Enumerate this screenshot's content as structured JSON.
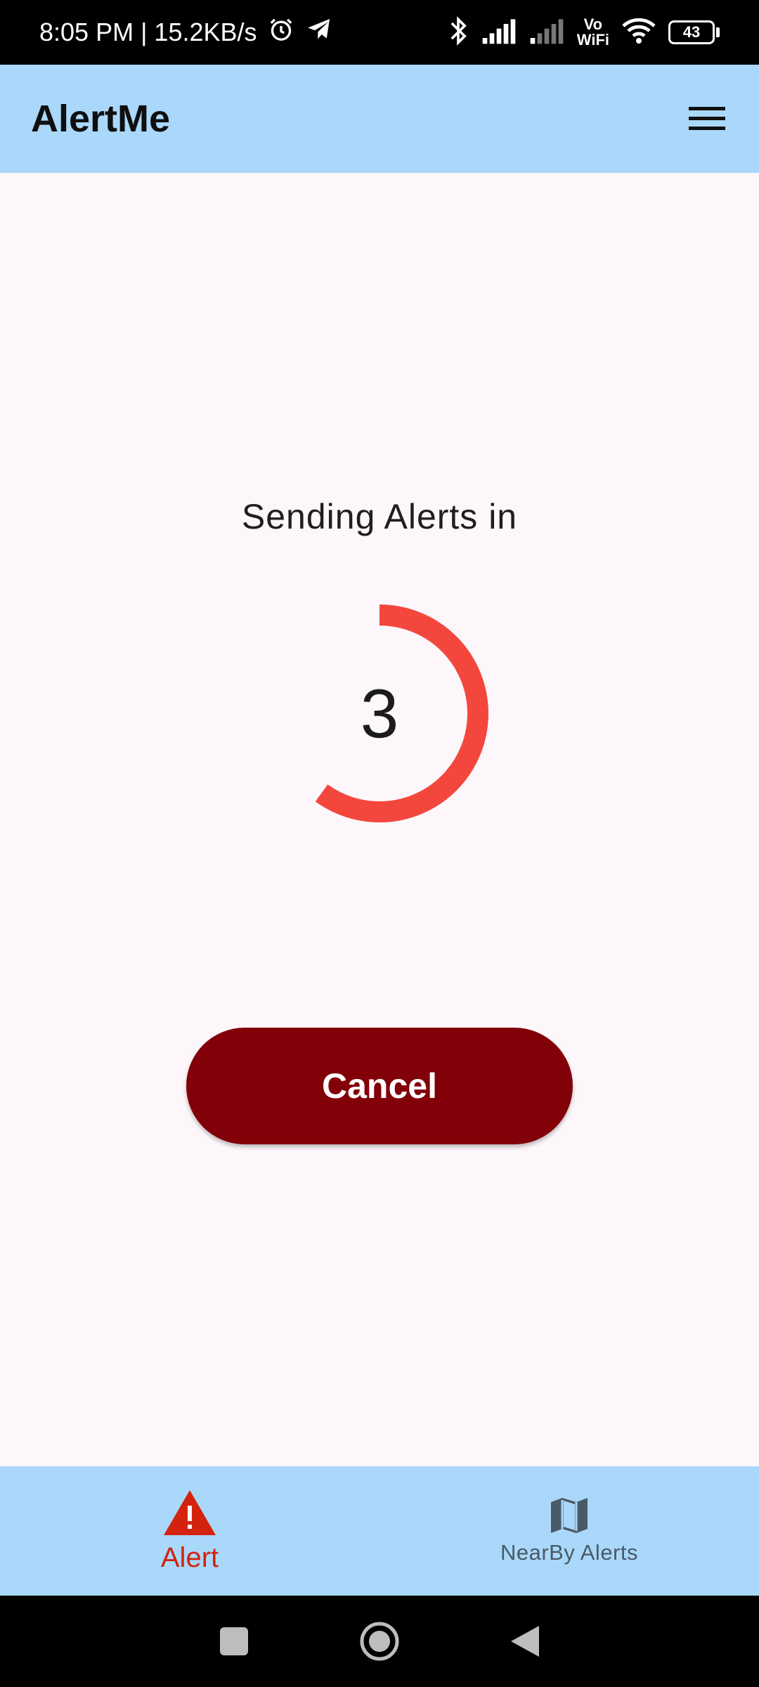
{
  "status_bar": {
    "time_speed": "8:05 PM | 15.2KB/s",
    "vowifi_top": "Vo",
    "vowifi_bottom": "WiFi",
    "battery": "43"
  },
  "app_bar": {
    "title": "AlertMe"
  },
  "main": {
    "sending_text": "Sending Alerts in",
    "countdown_value": "3",
    "countdown_progress": 0.6,
    "countdown_color": "#f3473e",
    "cancel_label": "Cancel",
    "cancel_color": "#820008"
  },
  "bottom_nav": {
    "items": [
      {
        "label": "Alert",
        "icon": "warning-triangle-icon",
        "active": true,
        "color": "#d3230f"
      },
      {
        "label": "NearBy Alerts",
        "icon": "map-icon",
        "active": false,
        "color": "#4a5a66"
      }
    ]
  },
  "system_nav": {
    "buttons": [
      "recents-square-icon",
      "home-circle-icon",
      "back-triangle-icon"
    ]
  }
}
